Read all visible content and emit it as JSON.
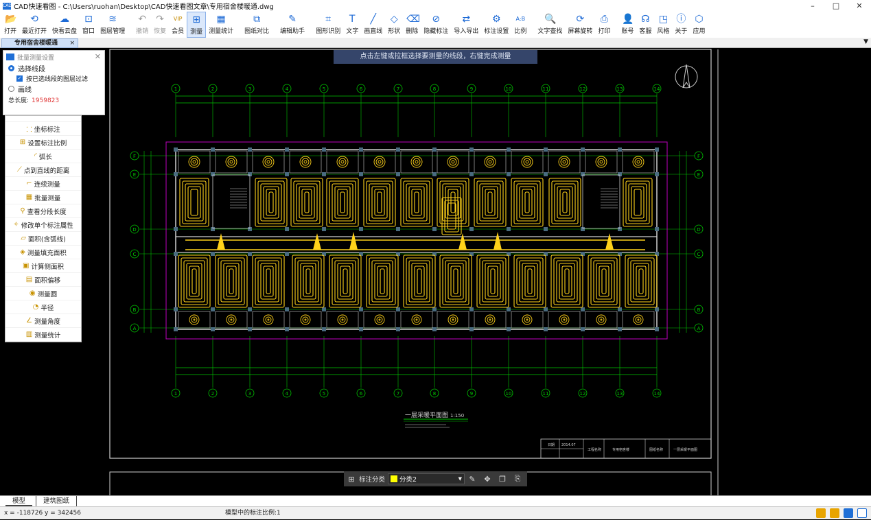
{
  "window": {
    "title": "CAD快速看图 - C:\\Users\\ruohan\\Desktop\\CAD快速看图文章\\专用宿舍楼暖通.dwg",
    "controls": [
      "–",
      "□",
      "✕"
    ]
  },
  "toolbar": [
    {
      "id": "open",
      "label": "打开",
      "icon": "📂",
      "state": "normal"
    },
    {
      "id": "recent",
      "label": "最近打开",
      "icon": "⟲",
      "state": "normal"
    },
    {
      "id": "cloud",
      "label": "快看云盘",
      "icon": "☁",
      "state": "normal"
    },
    {
      "id": "window",
      "label": "窗口",
      "icon": "⊡",
      "state": "normal"
    },
    {
      "id": "layers",
      "label": "图层管理",
      "icon": "≋",
      "state": "normal"
    },
    {
      "id": "undo",
      "label": "撤销",
      "icon": "↶",
      "state": "disabled"
    },
    {
      "id": "redo",
      "label": "恢复",
      "icon": "↷",
      "state": "disabled"
    },
    {
      "id": "vip",
      "label": "会员",
      "icon": "VIP",
      "state": "vip"
    },
    {
      "id": "measure",
      "label": "测量",
      "icon": "⊞",
      "state": "active"
    },
    {
      "id": "measure-stats",
      "label": "测量统计",
      "icon": "▦",
      "state": "normal"
    },
    {
      "id": "compare",
      "label": "图纸对比",
      "icon": "⧉",
      "state": "normal"
    },
    {
      "id": "edit-helper",
      "label": "编辑助手",
      "icon": "✎",
      "state": "normal"
    },
    {
      "id": "shape-recognize",
      "label": "图形识别",
      "icon": "⌗",
      "state": "normal"
    },
    {
      "id": "text",
      "label": "文字",
      "icon": "T",
      "state": "normal"
    },
    {
      "id": "line",
      "label": "画直线",
      "icon": "╱",
      "state": "normal"
    },
    {
      "id": "shape",
      "label": "形状",
      "icon": "◇",
      "state": "normal"
    },
    {
      "id": "delete",
      "label": "删除",
      "icon": "⌫",
      "state": "normal"
    },
    {
      "id": "hide-annot",
      "label": "隐藏标注",
      "icon": "⊘",
      "state": "normal"
    },
    {
      "id": "import-export",
      "label": "导入导出",
      "icon": "⇄",
      "state": "normal"
    },
    {
      "id": "annot-settings",
      "label": "标注设置",
      "icon": "⚙",
      "state": "normal"
    },
    {
      "id": "ratio",
      "label": "比例",
      "icon": "A:B",
      "state": "normal"
    },
    {
      "id": "text-search",
      "label": "文字查找",
      "icon": "🔍",
      "state": "normal"
    },
    {
      "id": "rotate",
      "label": "屏幕旋转",
      "icon": "⟳",
      "state": "normal"
    },
    {
      "id": "print",
      "label": "打印",
      "icon": "⎙",
      "state": "normal"
    },
    {
      "id": "account",
      "label": "账号",
      "icon": "👤",
      "state": "normal"
    },
    {
      "id": "service",
      "label": "客服",
      "icon": "☊",
      "state": "normal"
    },
    {
      "id": "style",
      "label": "风格",
      "icon": "◳",
      "state": "normal"
    },
    {
      "id": "about",
      "label": "关于",
      "icon": "ⓘ",
      "state": "normal"
    },
    {
      "id": "apps",
      "label": "应用",
      "icon": "⬡",
      "state": "normal"
    }
  ],
  "doc_tab": {
    "label": "专用宿舍楼暖通",
    "close": "×",
    "menu": "▼"
  },
  "hint": "点击左键或拉框选择要测量的线段，右键完成测量",
  "panel": {
    "title": "批量测量设置",
    "close": "✕",
    "option1": "选择线段",
    "checkbox": "按已选线段的图层过滤",
    "option2": "画线",
    "total_label": "总长度:",
    "total_value": "1959823"
  },
  "left_menu": [
    {
      "label": "坐标标注",
      "icon": "⸬"
    },
    {
      "label": "设置标注比例",
      "icon": "⊞"
    },
    {
      "label": "弧长",
      "icon": "◜"
    },
    {
      "label": "点到直线的距离",
      "icon": "⟋"
    },
    {
      "label": "连续测量",
      "icon": "⌐"
    },
    {
      "label": "批量测量",
      "icon": "▦"
    },
    {
      "label": "查看分段长度",
      "icon": "⚲"
    },
    {
      "label": "修改单个标注属性",
      "icon": "✧"
    },
    {
      "label": "面积(含弧线)",
      "icon": "▱"
    },
    {
      "label": "测量填充面积",
      "icon": "◈"
    },
    {
      "label": "计算侧面积",
      "icon": "▣"
    },
    {
      "label": "面积偏移",
      "icon": "▤"
    },
    {
      "label": "测量圆",
      "icon": "◉"
    },
    {
      "label": "半径",
      "icon": "◔"
    },
    {
      "label": "测量角度",
      "icon": "∠"
    },
    {
      "label": "测量统计",
      "icon": "▥"
    }
  ],
  "drawing": {
    "axis_numbers": [
      "1",
      "2",
      "3",
      "4",
      "5",
      "6",
      "7",
      "8",
      "9",
      "10",
      "11",
      "12",
      "13",
      "14"
    ],
    "row_letters_left": [
      "F",
      "E",
      "D",
      "C",
      "B",
      "A"
    ],
    "plan_title": "一层采暖平面图",
    "plan_scale": "1:150",
    "title_block": {
      "date_label": "日期",
      "date_value": "2014.07",
      "project": "工程名称",
      "building": "专用宿舍楼",
      "drawing_name_label": "图纸名称",
      "drawing_name": "一层采暖平面图"
    }
  },
  "bottom_tabs": [
    "模型",
    "建筑图纸"
  ],
  "status": {
    "coords": "x = -118726  y = 342456",
    "scale": "模型中的标注比例:1"
  },
  "float_bar": {
    "label": "标注分类",
    "selected": "分类2",
    "swatch": "#ffff00"
  },
  "colors": {
    "accent": "#1f6fd6",
    "heating": "#ffd21a",
    "grid": "#00c800",
    "wall": "#cfcfcf",
    "magenta": "#c000c0"
  }
}
